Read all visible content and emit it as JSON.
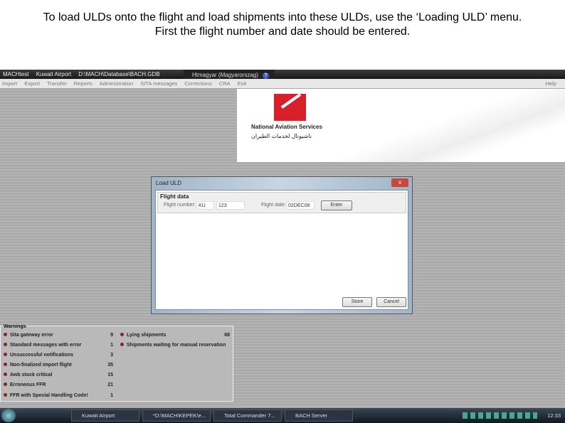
{
  "caption": {
    "line1": "To load ULDs onto the flight and load shipments into these ULDs, use the ‘Loading ULD’ menu.",
    "line2": "First the flight number and date should be entered."
  },
  "titlebar": {
    "app": "MACHtest",
    "airport": "Kuwait Airport",
    "path": "D:\\MACH\\Database\\BACH.GDB",
    "user": "Htmagyar (Magyarorszag)",
    "help": "?"
  },
  "menu": {
    "items": [
      "Import",
      "Export",
      "Transfer",
      "Reports",
      "Administration",
      "SITA messages",
      "Corrections",
      "CRA",
      "Exit"
    ],
    "help": "Help"
  },
  "logo": {
    "name": "National Aviation Services",
    "arabic": "ناشيونال لخدمات الطيران"
  },
  "dialog": {
    "title": "Load ULD",
    "close": "x",
    "group": "Flight data",
    "flight_number_label": "Flight number:",
    "carrier": "KU",
    "number": "123",
    "flight_date_label": "Flight date:",
    "flight_date": "02DEC08",
    "enter": "Enter",
    "store": "Store",
    "cancel": "Cancel"
  },
  "warnings": {
    "title": "Warnings",
    "left": [
      {
        "label": "Sita gateway error",
        "count": "9"
      },
      {
        "label": "Standard messages with error",
        "count": "1"
      },
      {
        "label": "Unsuccessful notifications",
        "count": "3"
      },
      {
        "label": "Non-finalized import flight",
        "count": "35"
      },
      {
        "label": "Awb stock critical",
        "count": "15"
      },
      {
        "label": "Erroneous FFR",
        "count": "21"
      },
      {
        "label": "FFR with Special Handling Code!",
        "count": "1"
      }
    ],
    "right": [
      {
        "label": "Lying shipments",
        "count": "68"
      },
      {
        "label": "Shipments waiting for manual reservation",
        "count": ""
      }
    ]
  },
  "taskbar": {
    "items": [
      "Kuwait Airport",
      "*D:\\MACH\\KEPEK\\e...",
      "Total Commander 7...",
      "BACH Server"
    ],
    "clock": "12:33"
  }
}
